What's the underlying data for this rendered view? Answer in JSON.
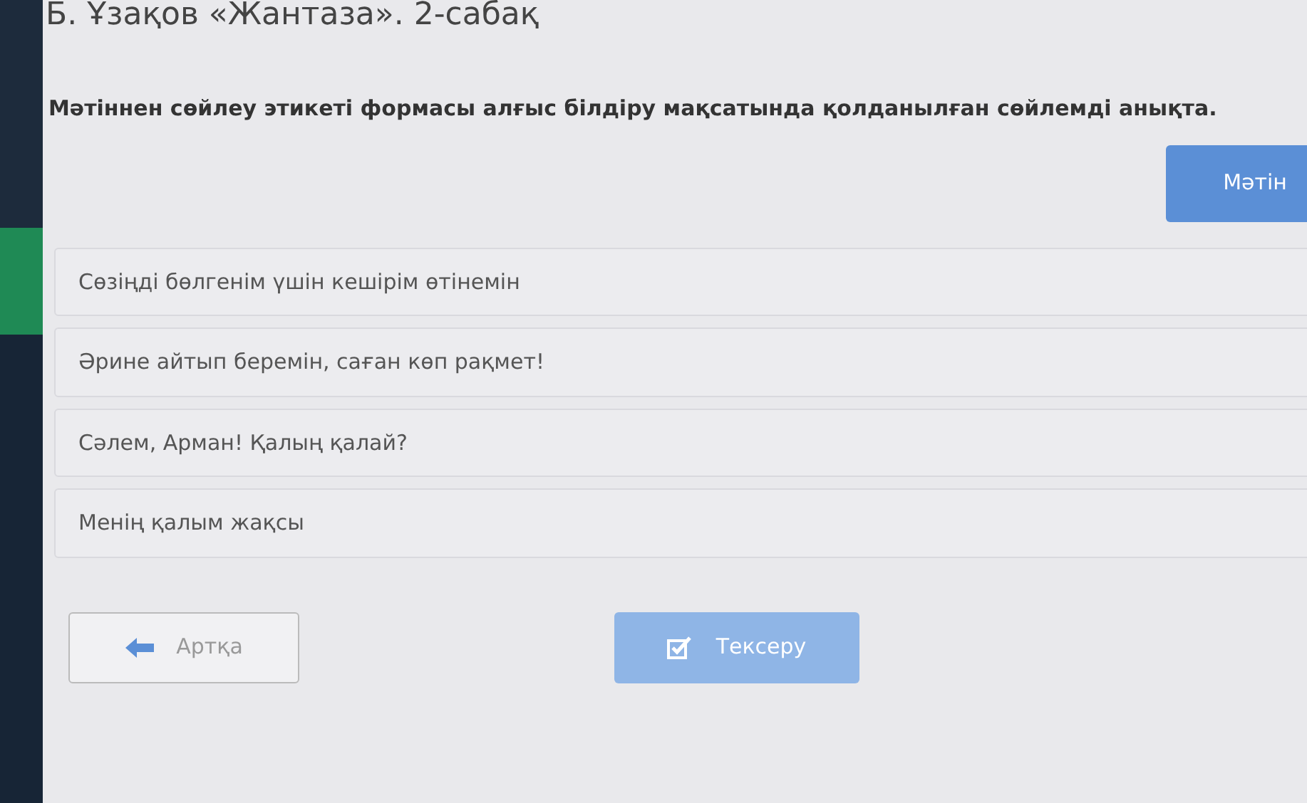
{
  "lesson_title": "Б. Ұзақов «Жантаза». 2-сабақ",
  "question": "Мәтіннен сөйлеу этикеті формасы алғыс білдіру мақсатында қолданылған сөйлемді анықта.",
  "text_button": "Мәтін",
  "options": [
    {
      "text": "Сөзіңді бөлгенім үшін кешірім өтінемін",
      "selected": false
    },
    {
      "text": "Әрине айтып беремін, саған көп рақмет!",
      "selected": false
    },
    {
      "text": "Сәлем, Арман! Қалың қалай?",
      "selected": false
    },
    {
      "text": "Менің қалым жақсы",
      "selected": false
    }
  ],
  "back_button": {
    "label": "Артқа"
  },
  "check_button": {
    "label": "Тексеру",
    "disabled": true
  }
}
